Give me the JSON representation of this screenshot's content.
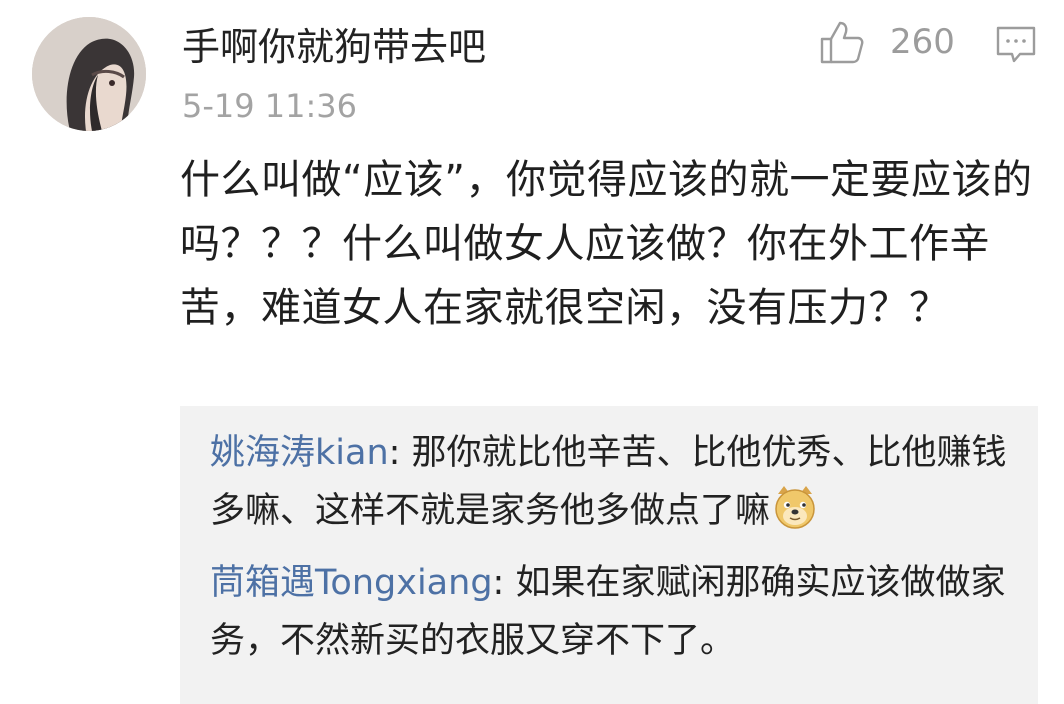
{
  "comment": {
    "username": "手啊你就狗带去吧",
    "timestamp": "5-19 11:36",
    "like_count": "260",
    "body": "什么叫做“应该”，你觉得应该的就一定要应该的吗？？？什么叫做女人应该做？你在外工作辛苦，难道女人在家就很空闲，没有压力？？",
    "icons": {
      "like": "thumbs-up-icon",
      "reply": "comment-icon",
      "emoji": "doge-emoji-icon"
    }
  },
  "replies": [
    {
      "user": "姚海涛kian",
      "separator": ":",
      "text": " 那你就比他辛苦、比他优秀、比他赚钱多嘛、这样不就是家务他多做点了嘛"
    },
    {
      "user": "茼箱遇Tongxiang",
      "separator": ":",
      "text": " 如果在家赋闲那确实应该做做家务，不然新买的衣服又穿不下了。"
    }
  ],
  "colors": {
    "username": "#222222",
    "timestamp": "#a3a3a3",
    "like_count": "#9c9c9c",
    "reply_user": "#4d71a5",
    "reply_background": "#f2f2f2"
  }
}
